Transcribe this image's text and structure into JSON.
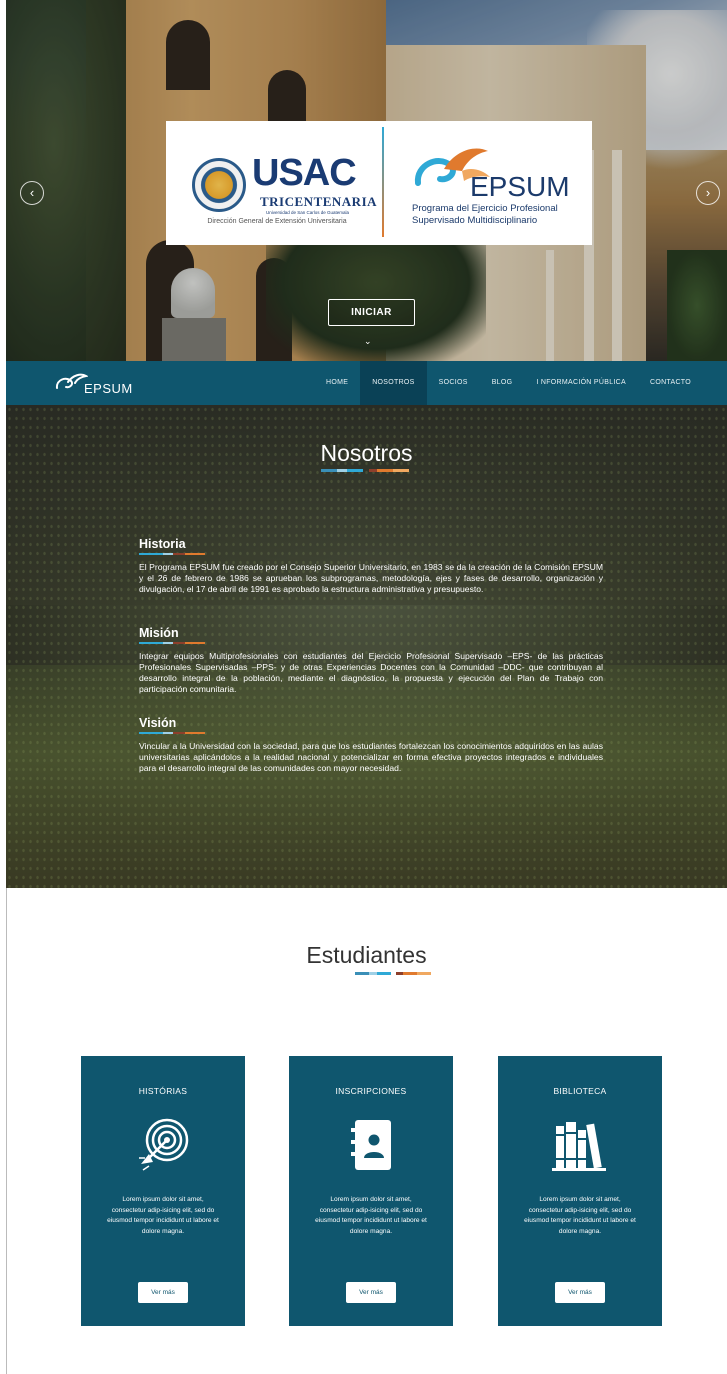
{
  "hero": {
    "usac": {
      "title": "USAC",
      "subtitle": "TRICENTENARIA",
      "university": "Universidad de San Carlos de Guatemala",
      "direction": "Dirección General de Extensión Universitaria"
    },
    "epsum": {
      "name": "EPSUM",
      "tagline_1": "Programa del Ejercicio Profesional",
      "tagline_2": "Supervisado Multidisciplinario"
    },
    "prev_icon": "chevron-left-icon",
    "next_icon": "chevron-right-icon",
    "cta_label": "INICIAR",
    "scroll_icon": "chevron-down-icon"
  },
  "navbar": {
    "logo_text": "EPSUM",
    "items": [
      {
        "label": "HOME",
        "active": false
      },
      {
        "label": "NOSOTROS",
        "active": true
      },
      {
        "label": "SOCIOS",
        "active": false
      },
      {
        "label": "BLOG",
        "active": false
      },
      {
        "label": "I NFORMACIÓN PÚBLICA",
        "active": false
      },
      {
        "label": "CONTACTO",
        "active": false
      }
    ],
    "bg_color": "#0f566e",
    "active_color": "#0a4156"
  },
  "nosotros": {
    "title": "Nosotros",
    "blocks": [
      {
        "heading": "Historia",
        "text": "El Programa EPSUM fue creado por el Consejo Superior Universitario, en 1983 se da la creación de la Comisión EPSUM y el 26 de febrero de 1986 se aprueban los subprogramas, metodología, ejes y fases de desarrollo, organización y divulgación, el 17 de abril de 1991 es aprobado la estructura administrativa y presupuesto."
      },
      {
        "heading": "Misión",
        "text": "Integrar equipos Multiprofesionales con estudiantes del Ejercicio Profesional Supervisado –EPS- de las prácticas Profesionales Supervisadas –PPS- y de otras Experiencias Docentes con la Comunidad –DDC- que contribuyan al desarrollo integral de la población, mediante el diagnóstico, la propuesta y ejecución del Plan de Trabajo con participación comunitaria."
      },
      {
        "heading": "Visión",
        "text": "Vincular a la Universidad con la sociedad, para que los estudiantes fortalezcan los conocimientos adquiridos en las aulas universitarias aplicándolos a la realidad nacional y potencializar en forma efectiva proyectos integrados e individuales para el desarrollo integral de las comunidades con mayor necesidad."
      }
    ]
  },
  "estudiantes": {
    "title": "Estudiantes",
    "cards": [
      {
        "title": "HISTÓRIAS",
        "icon": "target-icon",
        "text": "Lorem ipsum dolor sit amet, consectetur adip-isicing elit, sed do eiusmod tempor incididunt ut labore et dolore magna.",
        "button": "Ver más"
      },
      {
        "title": "INSCRIPCIONES",
        "icon": "contact-book-icon",
        "text": "Lorem ipsum dolor sit amet, consectetur adip-isicing elit, sed do eiusmod tempor incididunt ut labore et dolore magna.",
        "button": "Ver más"
      },
      {
        "title": "BIBLIOTECA",
        "icon": "books-icon",
        "text": "Lorem ipsum dolor sit amet, consectetur adip-isicing elit, sed do eiusmod tempor incididunt ut labore et dolore magna.",
        "button": "Ver más"
      }
    ],
    "card_color": "#0f566e"
  },
  "accent_colors": [
    "#3a8fb7",
    "#9fd0e6",
    "#2fa9d6",
    "#8d3f2b",
    "#e07a2e",
    "#f0a860"
  ]
}
